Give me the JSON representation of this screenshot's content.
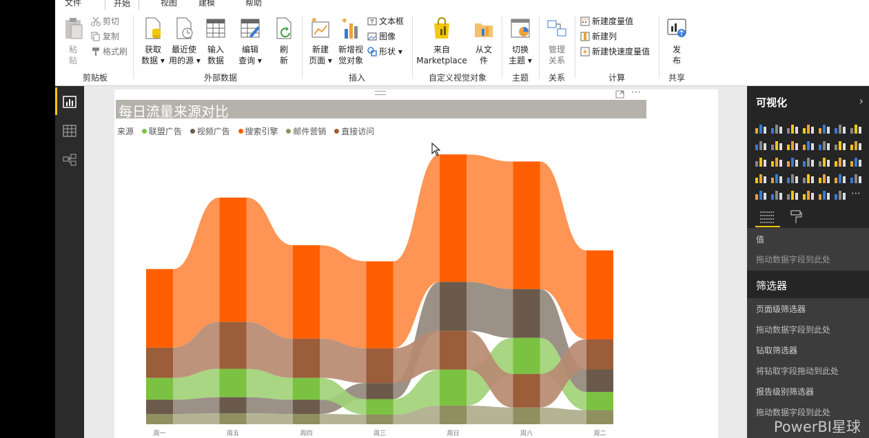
{
  "ribbon": {
    "tabs": [
      "文件",
      "开始",
      "视图",
      "建模",
      "帮助"
    ],
    "active_tab": "开始",
    "clipboard": {
      "paste": "粘\n贴",
      "cut": "剪切",
      "copy": "复制",
      "format_painter": "格式刷",
      "group": "剪贴板"
    },
    "external_data": {
      "get_data": "获取\n数据 ▾",
      "recent_sources": "最近使\n用的源 ▾",
      "enter_data": "输入\n数据",
      "edit_queries": "编辑\n查询 ▾",
      "refresh": "刷\n新",
      "group": "外部数据"
    },
    "insert": {
      "new_page": "新建\n页面 ▾",
      "new_visual": "新增视\n觉对象",
      "text_box": "文本框",
      "image": "图像",
      "shapes": "形状 ▾",
      "group": "插入"
    },
    "custom_visuals": {
      "marketplace": "来自\nMarketplace",
      "from_file": "从文\n件",
      "group": "自定义视觉对象"
    },
    "themes": {
      "switch_theme": "切换\n主题 ▾",
      "group": "主题"
    },
    "relationships": {
      "manage": "管理\n关系",
      "group": "关系"
    },
    "calculations": {
      "new_measure": "新建度量值",
      "new_column": "新建列",
      "new_quick_measure": "新建快速度量值",
      "group": "计算"
    },
    "share": {
      "publish": "发\n布",
      "group": "共享"
    }
  },
  "report": {
    "title": "每日流量来源对比",
    "legend_title": "来源",
    "legend": [
      {
        "name": "联盟广告",
        "color": "#7cc242"
      },
      {
        "name": "视频广告",
        "color": "#6b5a4b"
      },
      {
        "name": "搜索引擎",
        "color": "#ff5f00"
      },
      {
        "name": "邮件营销",
        "color": "#8f8f5f"
      },
      {
        "name": "直接访问",
        "color": "#9b5d3a"
      }
    ]
  },
  "chart_data": {
    "type": "area",
    "subtype": "ribbon",
    "title": "每日流量来源对比",
    "categories": [
      "周一",
      "周五",
      "周四",
      "周三",
      "周日",
      "周六",
      "周二"
    ],
    "series": [
      {
        "name": "邮件营销",
        "values": [
          16,
          17,
          16,
          15,
          29,
          26,
          22
        ]
      },
      {
        "name": "视频广告",
        "values": [
          22,
          25,
          22,
          25,
          76,
          76,
          35
        ]
      },
      {
        "name": "联盟广告",
        "values": [
          34,
          44,
          34,
          24,
          56,
          56,
          28
        ]
      },
      {
        "name": "直接访问",
        "values": [
          47,
          73,
          61,
          54,
          60,
          52,
          47
        ]
      },
      {
        "name": "搜索引擎",
        "values": [
          122,
          193,
          145,
          135,
          198,
          198,
          138
        ]
      }
    ],
    "colors": {
      "搜索引擎": "#ff5f00",
      "直接访问": "#9b5d3a",
      "联盟广告": "#7cc242",
      "视频广告": "#6b5a4b",
      "邮件营销": "#8f8f5f"
    },
    "ylim": [
      0,
      385
    ],
    "grid": false,
    "legend_position": "top-left"
  },
  "visualizations": {
    "title": "可视化",
    "values_label": "值",
    "drag_hint": "拖动数据字段到此处"
  },
  "filters": {
    "title": "筛选器",
    "page_level": "页面级筛选器",
    "drag_hint_1": "拖动数据字段到此处",
    "drillthrough": "钻取筛选器",
    "drillthrough_hint": "将钻取字段拖动到此处",
    "report_level": "报告级别筛选器",
    "drag_hint_2": "拖动数据字段到此处"
  },
  "watermark": "PowerBI星球"
}
